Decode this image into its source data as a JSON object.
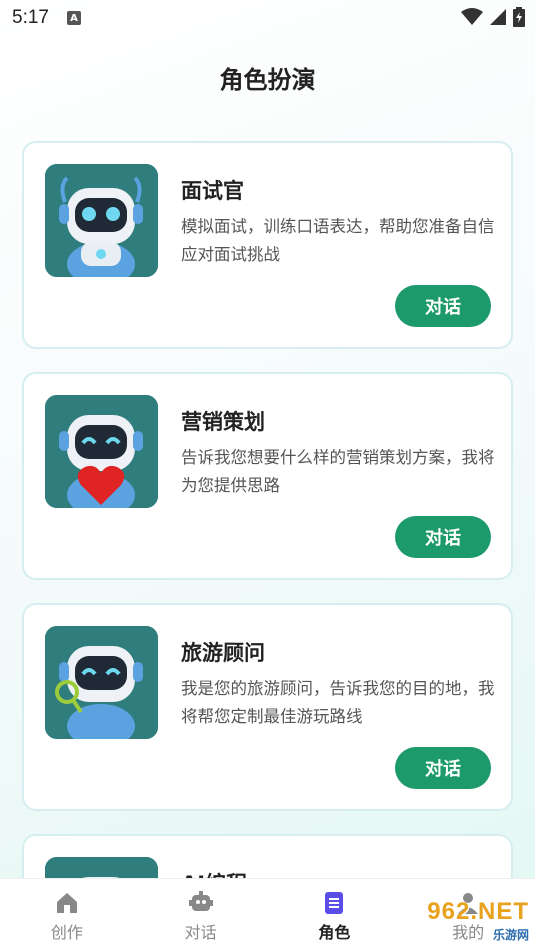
{
  "status": {
    "time": "5:17",
    "notify_letter": "A"
  },
  "page": {
    "title": "角色扮演"
  },
  "roles": [
    {
      "title": "面试官",
      "desc": "模拟面试，训练口语表达，帮助您准备自信应对面试挑战",
      "button": "对话",
      "avatar": "robot-avatar"
    },
    {
      "title": "营销策划",
      "desc": "告诉我您想要什么样的营销策划方案，我将为您提供思路",
      "button": "对话",
      "avatar": "robot-heart-avatar"
    },
    {
      "title": "旅游顾问",
      "desc": "我是您的旅游顾问，告诉我您的目的地，我将帮您定制最佳游玩路线",
      "button": "对话",
      "avatar": "robot-magnifier-avatar"
    },
    {
      "title": "AI编程",
      "desc": "",
      "button": "",
      "avatar": "robot-avatar"
    }
  ],
  "nav": [
    {
      "label": "创作",
      "icon": "home-icon",
      "active": false
    },
    {
      "label": "对话",
      "icon": "robot-icon",
      "active": false
    },
    {
      "label": "角色",
      "icon": "document-icon",
      "active": true
    },
    {
      "label": "我的",
      "icon": "person-icon",
      "active": false
    }
  ],
  "watermark": {
    "main": "962.NET",
    "sub": "乐游网"
  },
  "colors": {
    "accent": "#1d9a6c",
    "nav_active": "#5b4ee8",
    "card_border": "#d6eef0",
    "avatar_bg": "#2f7d7d"
  }
}
